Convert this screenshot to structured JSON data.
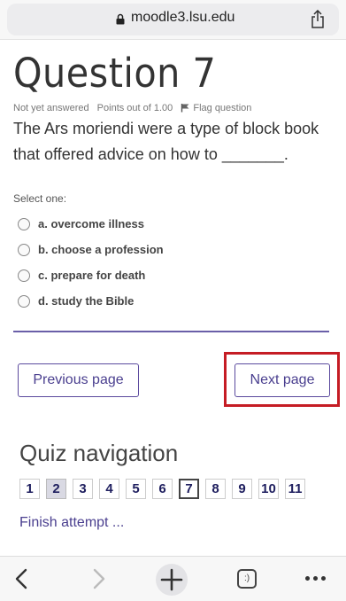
{
  "browser": {
    "url": "moodle3.lsu.edu",
    "tabs_glyph": ":)"
  },
  "question": {
    "title": "Question 7",
    "status": "Not yet answered",
    "points": "Points out of 1.00",
    "flag_label": "Flag question",
    "text": "The Ars moriendi were a type of block book that offered advice on how to _______."
  },
  "answers": {
    "prompt": "Select one:",
    "options": [
      "a. overcome illness",
      "b. choose a profession",
      "c. prepare for death",
      "d. study the Bible"
    ]
  },
  "buttons": {
    "previous": "Previous page",
    "next": "Next page"
  },
  "quiz_nav": {
    "title": "Quiz navigation",
    "questions": [
      "1",
      "2",
      "3",
      "4",
      "5",
      "6",
      "7",
      "8",
      "9",
      "10",
      "11"
    ],
    "answered": [
      "2"
    ],
    "current": "7",
    "finish": "Finish attempt ..."
  },
  "colors": {
    "accent": "#4a3f8f",
    "highlight": "#c51c24"
  }
}
